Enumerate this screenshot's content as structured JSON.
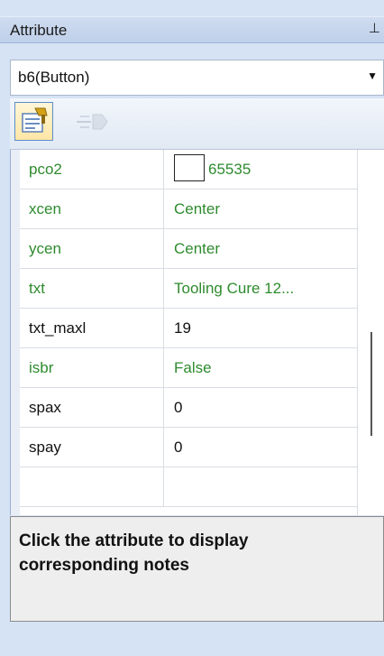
{
  "panel": {
    "title": "Attribute",
    "pin_glyph": "⊥",
    "pin_icon": "pin-icon"
  },
  "object_select": {
    "value": "b6(Button)",
    "arrow": "▼"
  },
  "toolbar": {
    "properties_icon": "properties-icon",
    "events_icon": "events-icon"
  },
  "colors": {
    "modified": "#2e8b2e",
    "default": "#111111"
  },
  "grid": {
    "rows": [
      {
        "name": "pco2",
        "value": "65535",
        "modified": true,
        "swatch": true
      },
      {
        "name": "xcen",
        "value": "Center",
        "modified": true
      },
      {
        "name": "ycen",
        "value": "Center",
        "modified": true
      },
      {
        "name": "txt",
        "value": "Tooling Cure 12...",
        "modified": true
      },
      {
        "name": "txt_maxl",
        "value": "19",
        "modified": false
      },
      {
        "name": "isbr",
        "value": "False",
        "modified": true
      },
      {
        "name": "spax",
        "value": "0",
        "modified": false
      },
      {
        "name": "spay",
        "value": "0",
        "modified": false
      },
      {
        "name": "",
        "value": "",
        "modified": false
      }
    ]
  },
  "notes": {
    "text": "Click the attribute to display corresponding notes"
  }
}
